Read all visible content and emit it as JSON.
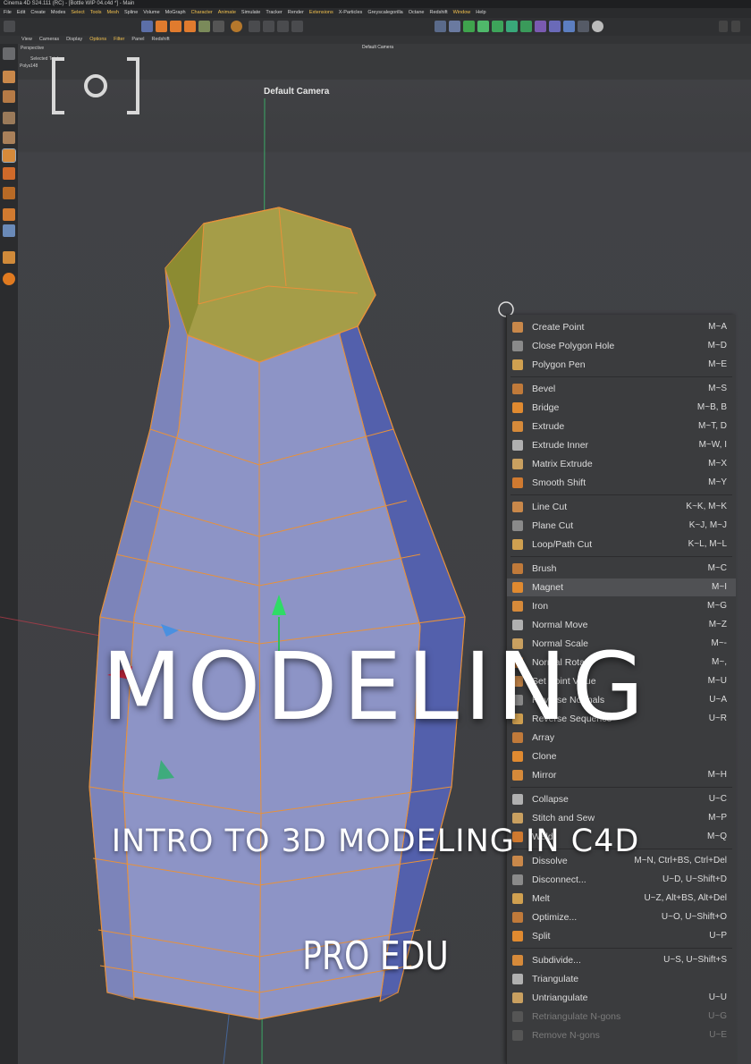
{
  "window": {
    "title": "Cinema 4D S24.111 (RC) - [Bottle WIP 04.c4d *] - Main"
  },
  "main_menu": [
    "File",
    "Edit",
    "Create",
    "Modes",
    "Select",
    "Tools",
    "Mesh",
    "Spline",
    "Volume",
    "MoGraph",
    "Character",
    "Animate",
    "Simulate",
    "Tracker",
    "Render",
    "Extensions",
    "X-Particles",
    "Greyscalegorilla",
    "Octane",
    "Redshift",
    "Window",
    "Help"
  ],
  "main_menu_highlight": [
    "Select",
    "Tools",
    "Mesh",
    "Character",
    "Animate",
    "Extensions",
    "Window"
  ],
  "viewport_menu": [
    "View",
    "Cameras",
    "Display",
    "Options",
    "Filter",
    "Panel",
    "Redshift"
  ],
  "viewport_menu_highlight": [
    "Options",
    "Filter"
  ],
  "viewport": {
    "name": "Default Camera",
    "small_label": "Default Camera",
    "panel_name": "Perspective",
    "selected_label": "Selected Total",
    "polys_label": "Polys",
    "polys_value": "148"
  },
  "context_menu": {
    "items": [
      {
        "label": "Create Point",
        "shortcut": "M~A"
      },
      {
        "label": "Close Polygon Hole",
        "shortcut": "M~D"
      },
      {
        "label": "Polygon Pen",
        "shortcut": "M~E",
        "sep_after": true
      },
      {
        "label": "Bevel",
        "shortcut": "M~S"
      },
      {
        "label": "Bridge",
        "shortcut": "M~B, B"
      },
      {
        "label": "Extrude",
        "shortcut": "M~T, D"
      },
      {
        "label": "Extrude Inner",
        "shortcut": "M~W, I"
      },
      {
        "label": "Matrix Extrude",
        "shortcut": "M~X"
      },
      {
        "label": "Smooth Shift",
        "shortcut": "M~Y",
        "sep_after": true
      },
      {
        "label": "Line Cut",
        "shortcut": "K~K, M~K"
      },
      {
        "label": "Plane Cut",
        "shortcut": "K~J, M~J"
      },
      {
        "label": "Loop/Path Cut",
        "shortcut": "K~L, M~L",
        "sep_after": true
      },
      {
        "label": "Brush",
        "shortcut": "M~C"
      },
      {
        "label": "Magnet",
        "shortcut": "M~I",
        "highlight": true
      },
      {
        "label": "Iron",
        "shortcut": "M~G"
      },
      {
        "label": "Normal Move",
        "shortcut": "M~Z"
      },
      {
        "label": "Normal Scale",
        "shortcut": "M~-"
      },
      {
        "label": "Normal Rotate",
        "shortcut": "M~,"
      },
      {
        "label": "Set Point Value",
        "shortcut": "M~U"
      },
      {
        "label": "Reverse Normals",
        "shortcut": "U~A"
      },
      {
        "label": "Reverse Sequence",
        "shortcut": "U~R"
      },
      {
        "label": "Array",
        "shortcut": ""
      },
      {
        "label": "Clone",
        "shortcut": ""
      },
      {
        "label": "Mirror",
        "shortcut": "M~H",
        "sep_after": true
      },
      {
        "label": "Collapse",
        "shortcut": "U~C"
      },
      {
        "label": "Stitch and Sew",
        "shortcut": "M~P"
      },
      {
        "label": "Weld",
        "shortcut": "M~Q",
        "sep_after": true
      },
      {
        "label": "Dissolve",
        "shortcut": "M~N, Ctrl+BS, Ctrl+Del"
      },
      {
        "label": "Disconnect...",
        "shortcut": "U~D, U~Shift+D"
      },
      {
        "label": "Melt",
        "shortcut": "U~Z, Alt+BS, Alt+Del"
      },
      {
        "label": "Optimize...",
        "shortcut": "U~O, U~Shift+O"
      },
      {
        "label": "Split",
        "shortcut": "U~P",
        "sep_after": true
      },
      {
        "label": "Subdivide...",
        "shortcut": "U~S, U~Shift+S"
      },
      {
        "label": "Triangulate",
        "shortcut": ""
      },
      {
        "label": "Untriangulate",
        "shortcut": "U~U"
      },
      {
        "label": "Retriangulate N-gons",
        "shortcut": "U~G",
        "dim": true
      },
      {
        "label": "Remove N-gons",
        "shortcut": "U~E",
        "dim": true
      }
    ]
  },
  "overlay": {
    "title": "MODELING",
    "subtitle": "INTRO TO 3D MODELING IN C4D",
    "brand": "PRO EDU"
  },
  "colors": {
    "accent": "#f2c14e",
    "mesh_face": "#8f96c8",
    "mesh_edge": "#e8913a",
    "mesh_selected": "#a9a24a",
    "menu_bg": "#3b3c3e"
  }
}
